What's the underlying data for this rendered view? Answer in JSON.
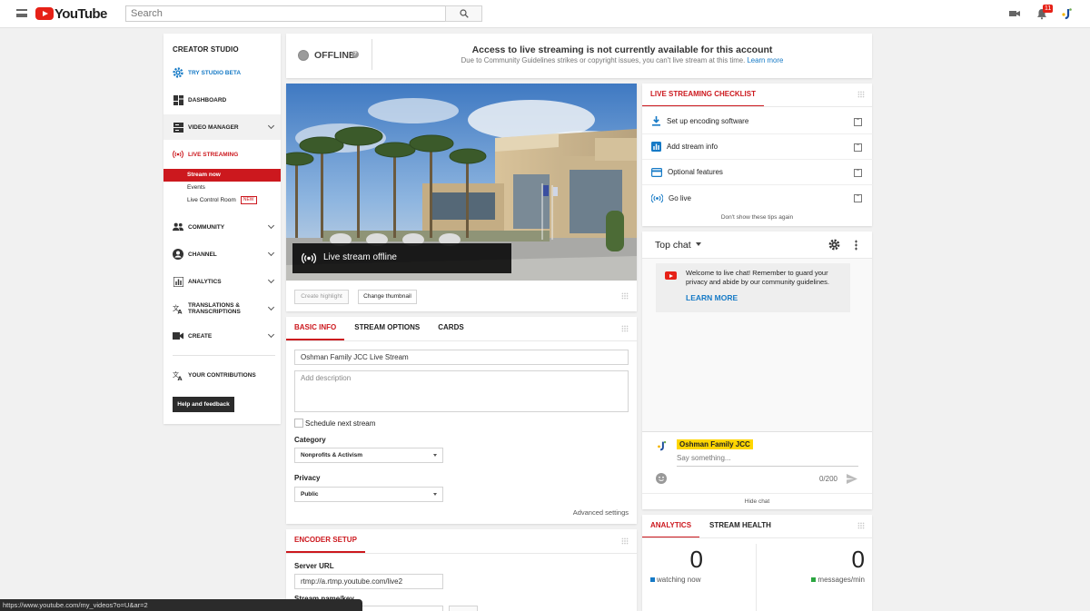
{
  "app": {
    "logo_text": "YouTube",
    "search_placeholder": "Search",
    "notification_count": "11"
  },
  "sidebar": {
    "title": "CREATOR STUDIO",
    "items": [
      {
        "label": "TRY STUDIO BETA"
      },
      {
        "label": "DASHBOARD"
      },
      {
        "label": "VIDEO MANAGER"
      },
      {
        "label": "LIVE STREAMING"
      },
      {
        "label": "COMMUNITY"
      },
      {
        "label": "CHANNEL"
      },
      {
        "label": "ANALYTICS"
      },
      {
        "label": "TRANSLATIONS & TRANSCRIPTIONS"
      },
      {
        "label": "CREATE"
      },
      {
        "label": "YOUR CONTRIBUTIONS"
      }
    ],
    "subitems": [
      "Stream now",
      "Events",
      "Live Control Room"
    ],
    "new_badge": "NEW",
    "help_button": "Help and feedback"
  },
  "status": {
    "state": "OFFLINE",
    "headline": "Access to live streaming is not currently available for this account",
    "detail": "Due to Community Guidelines strikes or copyright issues, you can't live stream at this time.",
    "link": "Learn more"
  },
  "preview": {
    "overlay_text": "Live stream offline",
    "create_highlight": "Create highlight",
    "change_thumbnail": "Change thumbnail"
  },
  "info_tabs": [
    "BASIC INFO",
    "STREAM OPTIONS",
    "CARDS"
  ],
  "basic_info": {
    "title_value": "Oshman Family JCC Live Stream",
    "description_placeholder": "Add description",
    "schedule_label": "Schedule next stream",
    "category_label": "Category",
    "category_value": "Nonprofits & Activism",
    "privacy_label": "Privacy",
    "privacy_value": "Public",
    "advanced": "Advanced settings"
  },
  "encoder": {
    "title": "ENCODER SETUP",
    "server_url_label": "Server URL",
    "server_url": "rtmp://a.rtmp.youtube.com/live2",
    "stream_key_label": "Stream name/key"
  },
  "checklist": {
    "title": "LIVE STREAMING CHECKLIST",
    "items": [
      "Set up encoding software",
      "Add stream info",
      "Optional features",
      "Go live"
    ],
    "dismiss": "Don't show these tips again"
  },
  "chat": {
    "mode": "Top chat",
    "welcome": "Welcome to live chat! Remember to guard your privacy and abide by our community guidelines.",
    "learn_more": "LEARN MORE",
    "username": "Oshman Family JCC",
    "input_placeholder": "Say something...",
    "counter": "0/200",
    "hide": "Hide chat"
  },
  "analytics": {
    "tabs": [
      "ANALYTICS",
      "STREAM HEALTH"
    ],
    "watching_value": "0",
    "watching_label": "watching now",
    "messages_value": "0",
    "messages_label": "messages/min"
  },
  "statusbar": {
    "url": "https://www.youtube.com/my_videos?o=U&ar=2"
  },
  "colors": {
    "accent": "#cc181e",
    "link": "#167ac6",
    "watching": "#167ac6",
    "messages": "#2ba640"
  }
}
